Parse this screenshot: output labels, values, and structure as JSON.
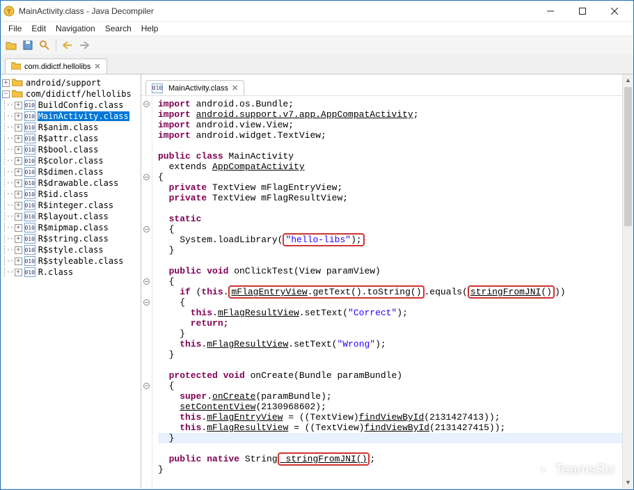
{
  "window": {
    "title": "MainActivity.class - Java Decompiler"
  },
  "menu": {
    "file": "File",
    "edit": "Edit",
    "nav": "Navigation",
    "search": "Search",
    "help": "Help"
  },
  "main_tab": {
    "label": "com.didictf.hellolibs"
  },
  "tree": {
    "n0": "android/support",
    "n1": "com/didictf/hellolibs",
    "c0": "BuildConfig.class",
    "c1": "MainActivity.class",
    "c2": "R$anim.class",
    "c3": "R$attr.class",
    "c4": "R$bool.class",
    "c5": "R$color.class",
    "c6": "R$dimen.class",
    "c7": "R$drawable.class",
    "c8": "R$id.class",
    "c9": "R$integer.class",
    "c10": "R$layout.class",
    "c11": "R$mipmap.class",
    "c12": "R$string.class",
    "c13": "R$style.class",
    "c14": "R$styleable.class",
    "c15": "R.class"
  },
  "editor_tab": {
    "label": "MainActivity.class"
  },
  "code": {
    "imp1_a": "import",
    "imp1_b": " android.os.Bundle;",
    "imp2_a": "import",
    "imp2_b": " ",
    "imp2_c": "android.support.v7.app.AppCompatActivity",
    "imp2_d": ";",
    "imp3_a": "import",
    "imp3_b": " android.view.View;",
    "imp4_a": "import",
    "imp4_b": " android.widget.TextView;",
    "cls_a": "public class",
    "cls_b": " MainActivity",
    "ext_a": "  extends ",
    "ext_b": "AppCompatActivity",
    "ob": "{",
    "f1_a": "  private",
    "f1_b": " TextView mFlagEntryView;",
    "f2_a": "  private",
    "f2_b": " TextView mFlagResultView;",
    "st_a": "  static",
    "ob2": "  {",
    "ll_a": "    System.loadLibrary(",
    "ll_b": "\"hello-libs\"",
    "ll_c": ");",
    "cb2": "  }",
    "m1_a": "  public void",
    "m1_b": " onClickTest(View paramView)",
    "ob3": "  {",
    "if_a": "    if",
    "if_b": " (",
    "if_c": "this",
    "if_d": ".",
    "if_e": "mFlagEntryView",
    "if_f": ".getText().toString()",
    "if_g": ".equals(",
    "if_h": "stringFromJNI",
    "if_i": "()",
    "if_j": "))",
    "ob4": "    {",
    "s1_a": "      this",
    "s1_b": ".",
    "s1_c": "mFlagResultView",
    "s1_d": ".setText(",
    "s1_e": "\"Correct\"",
    "s1_f": ");",
    "ret": "      return;",
    "cb4": "    }",
    "s2_a": "    this",
    "s2_b": ".",
    "s2_c": "mFlagResultView",
    "s2_d": ".setText(",
    "s2_e": "\"Wrong\"",
    "s2_f": ");",
    "cb3": "  }",
    "m2_a": "  protected void",
    "m2_b": " onCreate(Bundle paramBundle)",
    "ob5": "  {",
    "oc_a": "    super",
    "oc_b": ".",
    "oc_c": "onCreate",
    "oc_d": "(paramBundle);",
    "scv_a": "    ",
    "scv_b": "setContentView",
    "scv_c": "(2130968602);",
    "fv1_a": "    this",
    "fv1_b": ".",
    "fv1_c": "mFlagEntryView",
    "fv1_d": " = ((TextView)",
    "fv1_e": "findViewById",
    "fv1_f": "(2131427413));",
    "fv2_a": "    this",
    "fv2_b": ".",
    "fv2_c": "mFlagResultView",
    "fv2_d": " = ((TextView)",
    "fv2_e": "findViewById",
    "fv2_f": "(2131427415));",
    "cb5": "  }",
    "nat_a": "  public native",
    "nat_b": " String",
    "nat_c": " stringFromJNI()",
    "nat_d": ";",
    "cb": "}"
  },
  "watermark": "TeamsSix"
}
